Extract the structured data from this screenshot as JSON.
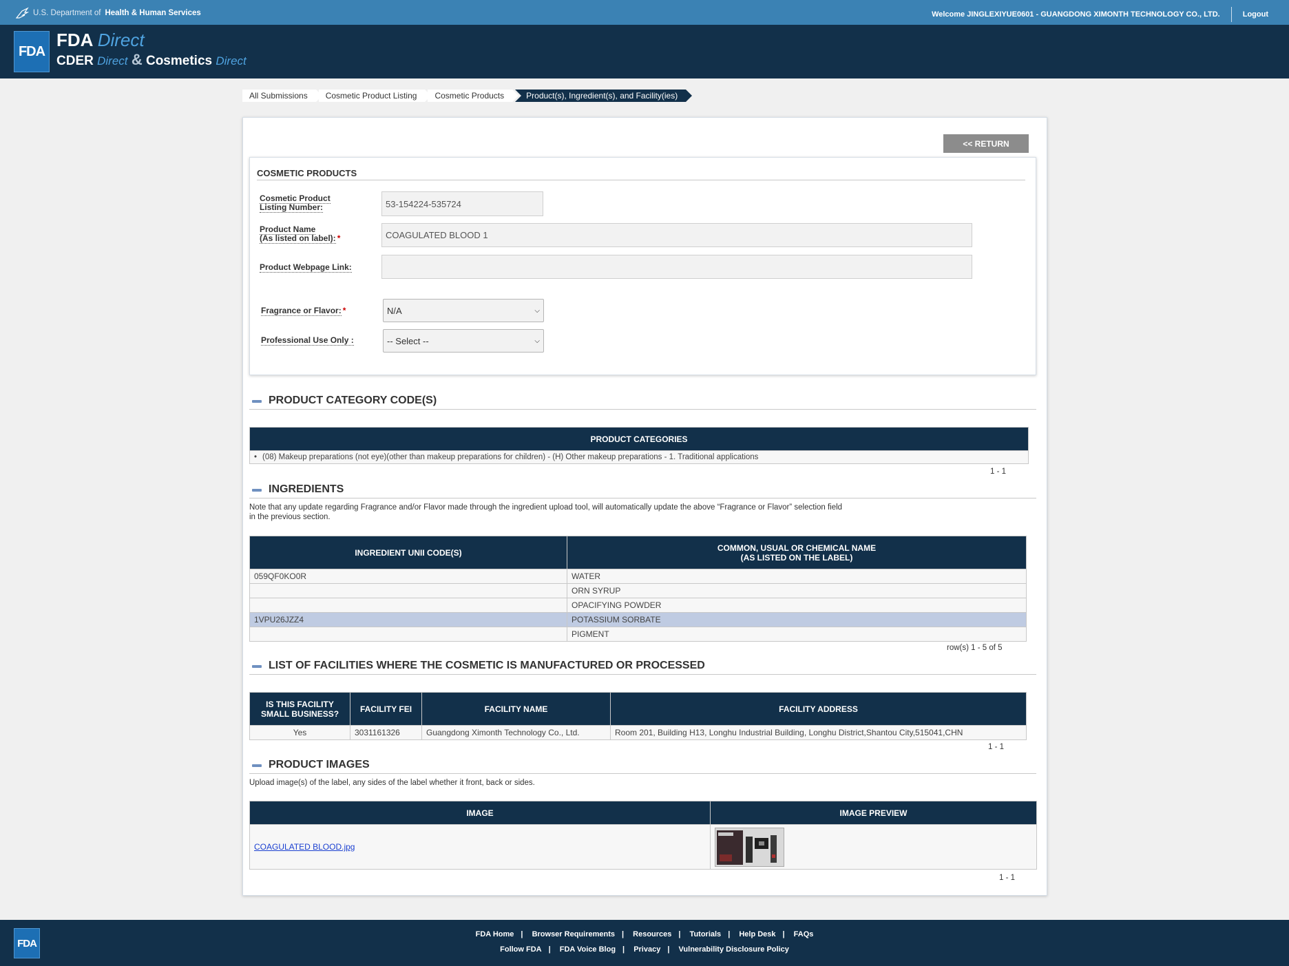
{
  "hhs": {
    "dept_prefix": "U.S. Department of",
    "dept_name": "Health & Human Services",
    "welcome": "Welcome JINGLEXIYUE0601 - GUANGDONG XIMONTH TECHNOLOGY CO., LTD.",
    "logout": "Logout"
  },
  "brand": {
    "logo_text": "FDA",
    "line1_bold": "FDA",
    "line1_italic": "Direct",
    "line2_a": "CDER",
    "line2_a_italic": "Direct",
    "line2_amp": "&",
    "line2_b": "Cosmetics",
    "line2_b_italic": "Direct"
  },
  "breadcrumbs": [
    "All Submissions",
    "Cosmetic Product Listing",
    "Cosmetic Products",
    "Product(s), Ingredient(s), and Facility(ies)"
  ],
  "return_label": "<< RETURN",
  "form": {
    "title": "COSMETIC PRODUCTS",
    "listing_number_label_1": "Cosmetic Product",
    "listing_number_label_2": "Listing Number:",
    "listing_number_value": "53-154224-535724",
    "product_name_label_1": "Product Name",
    "product_name_label_2": "(As listed on label):",
    "product_name_value": "COAGULATED BLOOD 1",
    "webpage_label": "Product Webpage Link:",
    "webpage_value": "",
    "fragrance_label": "Fragrance or Flavor:",
    "fragrance_value": "N/A",
    "professional_label": "Professional Use Only :",
    "professional_value": "-- Select --",
    "required_mark": "*"
  },
  "categories": {
    "section_title": "PRODUCT CATEGORY CODE(S)",
    "header": "PRODUCT CATEGORIES",
    "items": [
      "(08) Makeup preparations (not eye)(other than makeup preparations for children) - (H) Other makeup preparations - 1. Traditional applications"
    ],
    "pager": "1 - 1"
  },
  "ingredients": {
    "section_title": "INGREDIENTS",
    "note_line1": "Note that any update regarding Fragrance and/or Flavor made through the ingredient upload tool, will automatically update the above “Fragrance or Flavor” selection field",
    "note_line2": "in the previous section.",
    "col1": "INGREDIENT UNII CODE(S)",
    "col2_line1": "COMMON, USUAL OR CHEMICAL NAME",
    "col2_line2": "(AS LISTED ON THE LABEL)",
    "rows": [
      {
        "code": "059QF0KO0R",
        "name": "WATER"
      },
      {
        "code": "",
        "name": "ORN SYRUP"
      },
      {
        "code": "",
        "name": "OPACIFYING POWDER"
      },
      {
        "code": "1VPU26JZZ4",
        "name": "POTASSIUM SORBATE"
      },
      {
        "code": "",
        "name": "PIGMENT"
      }
    ],
    "pager": "row(s) 1 - 5 of 5"
  },
  "facilities": {
    "section_title": "LIST OF FACILITIES WHERE THE COSMETIC IS MANUFACTURED OR PROCESSED",
    "col1_line1": "IS THIS FACILITY",
    "col1_line2": "SMALL BUSINESS?",
    "col2": "FACILITY FEI",
    "col3": "FACILITY NAME",
    "col4": "FACILITY ADDRESS",
    "rows": [
      {
        "small": "Yes",
        "fei": "3031161326",
        "name": "Guangdong Ximonth Technology Co., Ltd.",
        "address": "Room 201, Building H13, Longhu Industrial Building, Longhu District,Shantou City,515041,CHN"
      }
    ],
    "pager": "1 - 1"
  },
  "images": {
    "section_title": "PRODUCT IMAGES",
    "note": "Upload image(s) of the label, any sides of the label whether it front, back or sides.",
    "col1": "IMAGE",
    "col2": "IMAGE PREVIEW",
    "file_name": "COAGULATED BLOOD.jpg",
    "pager": "1 - 1"
  },
  "footer": {
    "logo_text": "FDA",
    "row1": [
      "FDA Home",
      "Browser Requirements",
      "Resources",
      "Tutorials",
      "Help Desk",
      "FAQs"
    ],
    "row2": [
      "Follow FDA",
      "FDA Voice Blog",
      "Privacy",
      "Vulnerability Disclosure Policy"
    ],
    "separator": "|"
  },
  "colors": {
    "hhs_bar": "#3b82b4",
    "header_navy": "#12304a",
    "accent_blue": "#4fa3e0",
    "row_highlight": "#bfcbe2"
  }
}
